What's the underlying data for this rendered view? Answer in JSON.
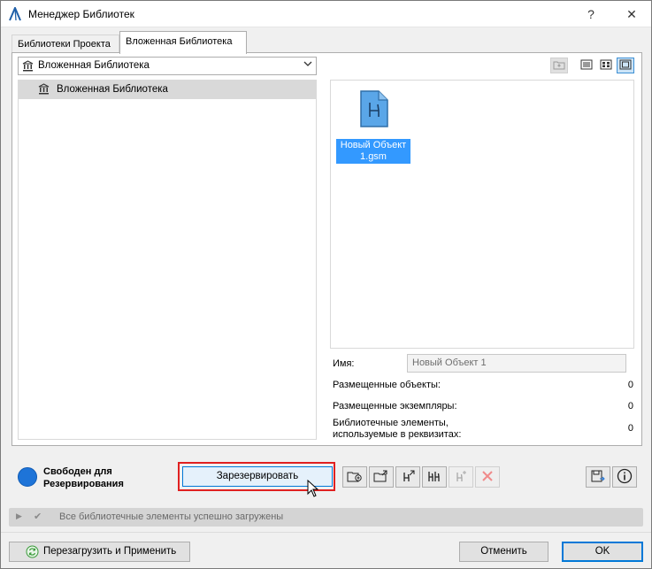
{
  "window": {
    "title": "Менеджер Библиотек",
    "help_label": "?",
    "close_label": "✕"
  },
  "tabs": [
    {
      "label": "Библиотеки Проекта",
      "active": false
    },
    {
      "label": "Вложенная Библиотека",
      "active": true
    }
  ],
  "library_select": {
    "value": "Вложенная Библиотека"
  },
  "tree": {
    "items": [
      {
        "label": "Вложенная Библиотека",
        "selected": true
      }
    ]
  },
  "view_buttons": [
    {
      "icon": "parent-folder-icon",
      "disabled": true
    },
    {
      "icon": "list-view-icon"
    },
    {
      "icon": "grid-view-icon"
    },
    {
      "icon": "large-icon-view-icon",
      "selected": true
    }
  ],
  "preview": {
    "file": {
      "name": "Новый Объект 1.gsm",
      "name_line1": "Новый Объект",
      "name_line2": "1.gsm",
      "icon": "chair-file-icon"
    }
  },
  "info": {
    "name_label": "Имя:",
    "name_value": "Новый Объект 1",
    "placed_objects_label": "Размещенные объекты:",
    "placed_objects_value": "0",
    "placed_instances_label": "Размещенные экземпляры:",
    "placed_instances_value": "0",
    "attr_elements_label_1": "Библиотечные элементы,",
    "attr_elements_label_2": "используемые в реквизитах:",
    "attr_elements_value": "0"
  },
  "status": {
    "line1": "Свободен для",
    "line2": "Резервирования",
    "color": "#1e74d8"
  },
  "actions": {
    "reserve_label": "Зарезервировать",
    "icon_buttons": [
      "add-file-icon",
      "import-folder-icon",
      "import-object-icon",
      "objects-icon",
      "objects-add-icon",
      "delete-icon"
    ],
    "save_icon": "save-export-icon",
    "info_icon": "info-icon"
  },
  "loaded_status": {
    "text": "Все библиотечные элементы успешно загружены"
  },
  "footer": {
    "reload_label": "Перезагрузить и Применить",
    "cancel_label": "Отменить",
    "ok_label": "OK"
  },
  "colors": {
    "accent": "#0078d7",
    "highlight": "#3399ff",
    "delete": "#e57373"
  }
}
